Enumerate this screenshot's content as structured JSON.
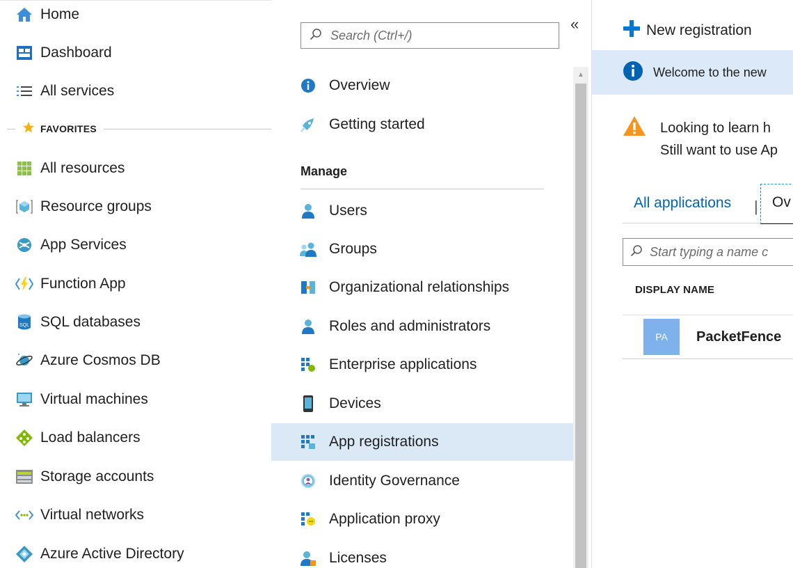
{
  "left_nav": {
    "items_top": [
      {
        "label": "Home",
        "icon": "home-icon"
      },
      {
        "label": "Dashboard",
        "icon": "dashboard-icon"
      },
      {
        "label": "All services",
        "icon": "list-icon"
      }
    ],
    "favorites_label": "FAVORITES",
    "favorites": [
      {
        "label": "All resources",
        "icon": "grid-icon"
      },
      {
        "label": "Resource groups",
        "icon": "cube-icon"
      },
      {
        "label": "App Services",
        "icon": "globe-icon"
      },
      {
        "label": "Function App",
        "icon": "bolt-icon"
      },
      {
        "label": "SQL databases",
        "icon": "database-icon"
      },
      {
        "label": "Azure Cosmos DB",
        "icon": "planet-icon"
      },
      {
        "label": "Virtual machines",
        "icon": "monitor-icon"
      },
      {
        "label": "Load balancers",
        "icon": "diamond-icon"
      },
      {
        "label": "Storage accounts",
        "icon": "storage-icon"
      },
      {
        "label": "Virtual networks",
        "icon": "network-icon"
      },
      {
        "label": "Azure Active Directory",
        "icon": "aad-icon"
      }
    ]
  },
  "menu": {
    "search_placeholder": "Search (Ctrl+/)",
    "collapse_glyph": "«",
    "items_top": [
      {
        "label": "Overview",
        "icon": "info-icon"
      },
      {
        "label": "Getting started",
        "icon": "rocket-icon"
      }
    ],
    "section_manage": "Manage",
    "manage_items": [
      {
        "label": "Users",
        "icon": "user-icon"
      },
      {
        "label": "Groups",
        "icon": "group-icon"
      },
      {
        "label": "Organizational relationships",
        "icon": "org-icon"
      },
      {
        "label": "Roles and administrators",
        "icon": "role-icon"
      },
      {
        "label": "Enterprise applications",
        "icon": "enterprise-apps-icon"
      },
      {
        "label": "Devices",
        "icon": "device-icon"
      },
      {
        "label": "App registrations",
        "icon": "app-registrations-icon",
        "selected": true
      },
      {
        "label": "Identity Governance",
        "icon": "governance-icon"
      },
      {
        "label": "Application proxy",
        "icon": "proxy-icon"
      },
      {
        "label": "Licenses",
        "icon": "license-icon"
      }
    ]
  },
  "content": {
    "new_registration": "New registration",
    "info_text": "Welcome to the new",
    "warning_line1": "Looking to learn h",
    "warning_line2": "Still want to use Ap",
    "tab_all": "All applications",
    "tab_owned": "Ov",
    "filter_placeholder": "Start typing a name c",
    "column_display_name": "DISPLAY NAME",
    "app_initials": "PA",
    "app_name": "PacketFence"
  },
  "colors": {
    "accent_blue": "#0078d4",
    "selected_bg": "#dbe9f7",
    "info_bg": "#dce9f8",
    "warning": "#f7941d",
    "avatar_bg": "#7fb1ec"
  }
}
